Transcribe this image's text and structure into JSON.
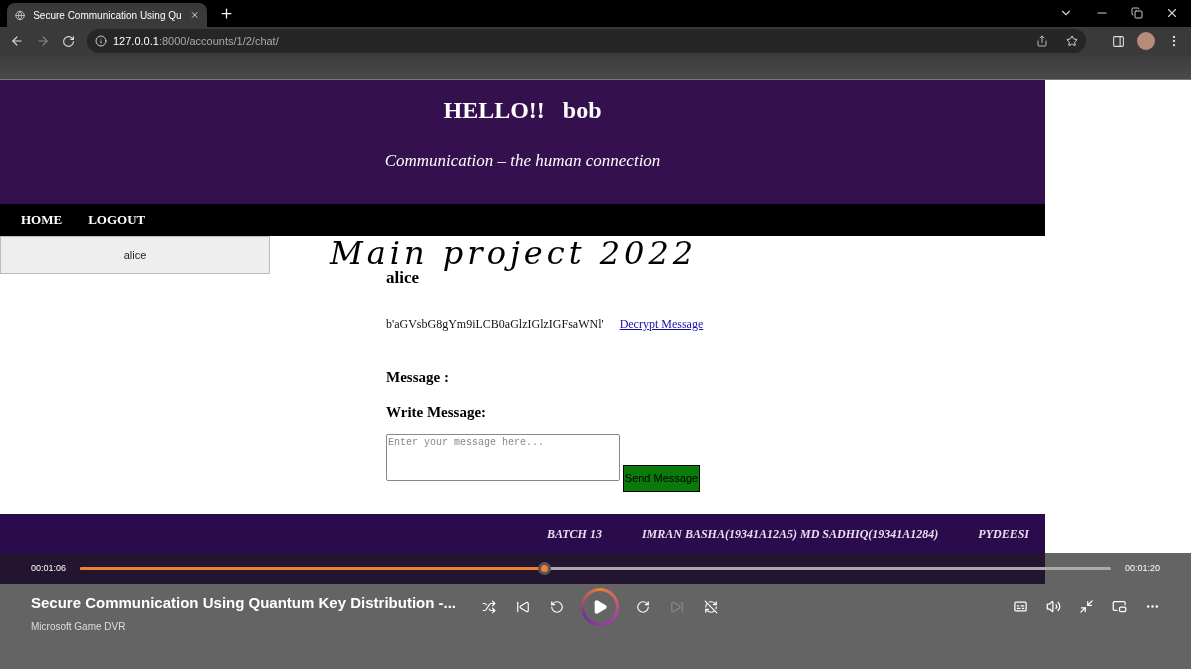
{
  "browser": {
    "tab_title": "Secure Communication Using Qu",
    "url_host": "127.0.0.1",
    "url_path": ":8000/accounts/1/2/chat/"
  },
  "header": {
    "greeting": "HELLO!!",
    "username": "bob",
    "subtitle": "Communication – the human connection"
  },
  "nav": [
    "HOME",
    "LOGOUT"
  ],
  "dropdown": {
    "items": [
      "alice"
    ]
  },
  "banner": "Main project 2022",
  "chat": {
    "contact": "alice",
    "cipher": "b'aGVsbG8gYm9iLCB0aGlzIGlzIGFsaWNl'",
    "decrypt_link": "Decrypt Message",
    "message_label": "Message :",
    "write_label": "Write Message:",
    "placeholder": "Enter your message here...",
    "send_button": "Send Message"
  },
  "footer": [
    "BATCH 13",
    "IMRAN BASHA(19341A12A5) MD SADHIQ(19341A1284)",
    "PYDEESI"
  ],
  "player": {
    "elapsed": "00:01:06",
    "total": "00:01:20",
    "level": 0.45,
    "title": "Secure Communication Using Quantum Key Distribution -...",
    "source": "Microsoft Game DVR",
    "controls": [
      {
        "kind": "shuffle",
        "disabled": false
      },
      {
        "kind": "previous",
        "disabled": false
      },
      {
        "kind": "back10",
        "disabled": false
      },
      {
        "kind": "play",
        "disabled": false
      },
      {
        "kind": "forward30",
        "disabled": false
      },
      {
        "kind": "next",
        "disabled": true
      },
      {
        "kind": "repeat",
        "disabled": false
      }
    ],
    "extras": [
      {
        "kind": "captions"
      },
      {
        "kind": "volume"
      },
      {
        "kind": "exit-fullscreen"
      },
      {
        "kind": "mini-view"
      },
      {
        "kind": "more"
      }
    ]
  }
}
